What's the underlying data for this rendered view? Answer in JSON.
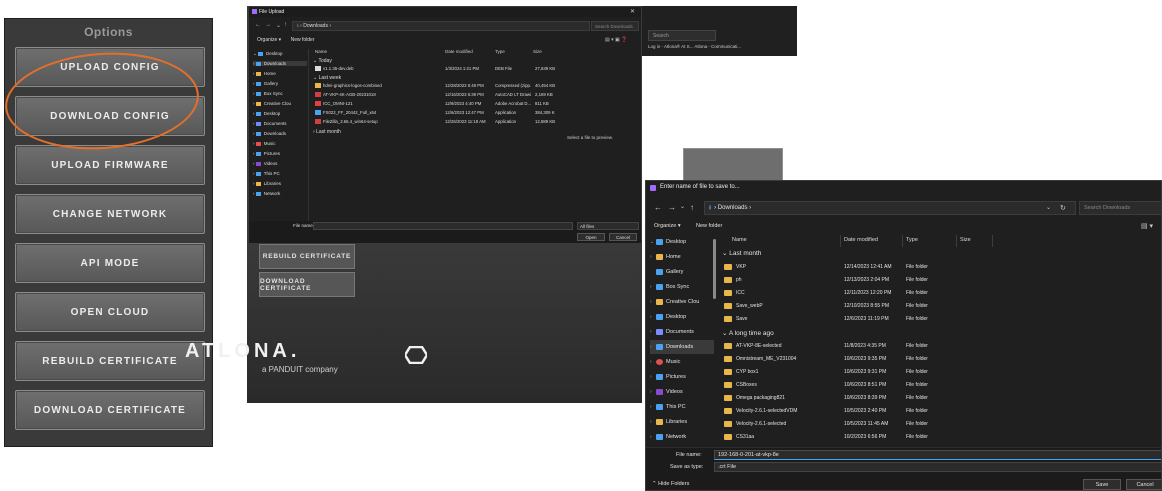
{
  "options_panel": {
    "title": "Options",
    "buttons": [
      "UPLOAD CONFIG",
      "DOWNLOAD CONFIG",
      "UPLOAD FIRMWARE",
      "CHANGE NETWORK",
      "API MODE",
      "OPEN CLOUD",
      "REBUILD CERTIFICATE",
      "DOWNLOAD CERTIFICATE"
    ],
    "highlight_color": "#e2702a"
  },
  "atlona": {
    "buttons": [
      "REBUILD CERTIFICATE",
      "DOWNLOAD CERTIFICATE"
    ],
    "logo": "ATLONA.",
    "tagline": "a PANDUIT company"
  },
  "browser": {
    "search_placeholder": "Search",
    "tabs": "Log in - Atlona® At S... Atlona - Communicati..."
  },
  "upload_dialog": {
    "title": "File Upload",
    "address": "Downloads",
    "search_placeholder": "Search Downloads",
    "organize": "Organize",
    "new_folder": "New folder",
    "nav": [
      "Desktop",
      "Downloads",
      "Home",
      "Gallery",
      "Box Sync",
      "Creative Clou",
      "Desktop",
      "Documents",
      "Downloads",
      "Music",
      "Pictures",
      "Videos",
      "This PC",
      "Libraries",
      "Network"
    ],
    "columns": [
      "Name",
      "Date modified",
      "Type",
      "Size"
    ],
    "groups": [
      "Today",
      "Last week",
      "Last month"
    ],
    "today_rows": [
      {
        "name": "v1.1.35-dev.deb",
        "date": "1/3/2024 1:21 PM",
        "type": "DEB File",
        "size": "27,639 KB"
      }
    ],
    "lastweek_rows": [
      {
        "name": "hdmi-graphics-logos-combined",
        "date": "12/28/2023 5:48 PM",
        "type": "Compressed (zipp...",
        "size": "40,454 KB"
      },
      {
        "name": "AT-VKP-4K-AGB-20231018",
        "date": "12/16/2023 6:39 PM",
        "type": "AutoCAD LT Drawi...",
        "size": "2,169 KB"
      },
      {
        "name": "ICC_OMNI-121",
        "date": "12/9/2023 4:40 PM",
        "type": "Adobe Acrobat D...",
        "size": "811 KB"
      },
      {
        "name": "FS022_FF_20442_Full_x64",
        "date": "12/6/2023 12:47 PM",
        "type": "Application",
        "size": "384,309 KB"
      },
      {
        "name": "FileZilla_3.66.4_win64-setup",
        "date": "12/26/2023 11:18 AM",
        "type": "Application",
        "size": "12,889 KB"
      }
    ],
    "preview": "Select a file to preview.",
    "file_name_label": "File name:",
    "filter": "All files",
    "open": "Open",
    "cancel": "Cancel"
  },
  "save_dialog": {
    "title": "Enter name of file to save to...",
    "address": "Downloads",
    "search_placeholder": "Search Downloads",
    "organize": "Organize ▾",
    "new_folder": "New folder",
    "nav": [
      "Desktop",
      "Home",
      "Gallery",
      "Box Sync",
      "Creative Clou",
      "Desktop",
      "Documents",
      "Downloads",
      "Music",
      "Pictures",
      "Videos",
      "This PC",
      "Libraries",
      "Network"
    ],
    "columns": [
      "Name",
      "Date modified",
      "Type",
      "Size"
    ],
    "groups": [
      "Last month",
      "A long time ago"
    ],
    "lastmonth_rows": [
      {
        "name": "VKP",
        "date": "12/14/2023 12:41 AM",
        "type": "File folder"
      },
      {
        "name": "ph",
        "date": "12/13/2023 2:04 PM",
        "type": "File folder"
      },
      {
        "name": "ICC",
        "date": "12/11/2023 12:20 PM",
        "type": "File folder"
      },
      {
        "name": "Save_webP",
        "date": "12/10/2023 8:55 PM",
        "type": "File folder"
      },
      {
        "name": "Save",
        "date": "12/6/2023 11:19 PM",
        "type": "File folder"
      }
    ],
    "longago_rows": [
      {
        "name": "AT-VKP-8E-selected",
        "date": "11/8/2023 4:35 PM",
        "type": "File folder"
      },
      {
        "name": "Omnistream_ME_V231004",
        "date": "10/6/2023 9:35 PM",
        "type": "File folder"
      },
      {
        "name": "CYP box1",
        "date": "10/6/2023 9:31 PM",
        "type": "File folder"
      },
      {
        "name": "CSBoxes",
        "date": "10/6/2023 8:51 PM",
        "type": "File folder"
      },
      {
        "name": "Omega packaging821",
        "date": "10/6/2023 8:39 PM",
        "type": "File folder"
      },
      {
        "name": "Velocity-2.6.1-selectedVDM",
        "date": "10/5/2023 2:40 PM",
        "type": "File folder"
      },
      {
        "name": "Velocity-2.6.1-selected",
        "date": "10/5/2023 11:45 AM",
        "type": "File folder"
      },
      {
        "name": "CS31aa",
        "date": "10/2/2023 6:56 PM",
        "type": "File folder"
      }
    ],
    "file_name_label": "File name:",
    "file_name_value": "192-168-0-201-at-vkp-8e",
    "save_type_label": "Save as type:",
    "save_type_value": ".crt File",
    "hide_folders": "Hide Folders",
    "save": "Save",
    "cancel": "Cancel"
  }
}
